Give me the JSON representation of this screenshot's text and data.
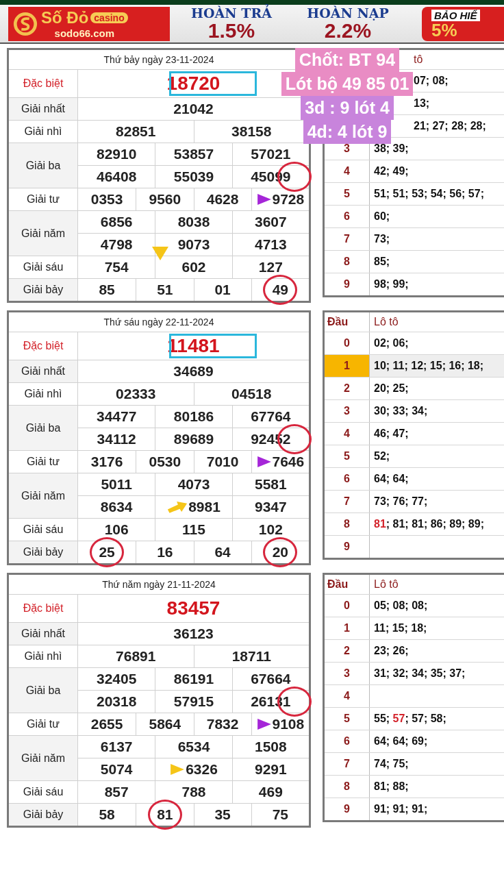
{
  "banner": {
    "brand": "Số Đỏ",
    "brand_tag": "casino",
    "site": "sodo66.com",
    "offers": [
      {
        "title": "HOÀN TRẢ",
        "value": "1.5%"
      },
      {
        "title": "HOÀN NẠP",
        "value": "2.2%"
      }
    ],
    "promo": {
      "title": "BẢO HIỂ",
      "value": "5%"
    }
  },
  "days": [
    {
      "date": "Thứ bảy ngày 23-11-2024",
      "note": [
        "Chốt: BT 94",
        "Lót bộ 49 85 01",
        "3d : 9 lót 4",
        "4d: 4 lót 9"
      ],
      "prizes": [
        {
          "label": "Đặc biệt",
          "kind": "special",
          "rows": [
            [
              {
                "v": "18720",
                "kind": "boxed"
              }
            ]
          ]
        },
        {
          "label": "Giải nhất",
          "kind": "normal",
          "rows": [
            [
              {
                "v": "21042",
                "kind": "plain"
              }
            ]
          ]
        },
        {
          "label": "Giải nhì",
          "kind": "normal",
          "rows": [
            [
              {
                "v": "82851",
                "kind": "plain"
              },
              {
                "v": "38158",
                "kind": "plain"
              }
            ]
          ]
        },
        {
          "label": "Giải ba",
          "kind": "normal",
          "rows": [
            [
              {
                "v": "82910",
                "kind": "plain"
              },
              {
                "v": "53857",
                "kind": "plain"
              },
              {
                "v": "57021",
                "kind": "plain"
              }
            ],
            [
              {
                "v": "46408",
                "kind": "plain"
              },
              {
                "v": "55039",
                "kind": "plain"
              },
              {
                "v": "45099",
                "kind": "tailcircled"
              }
            ]
          ]
        },
        {
          "label": "Giải tư",
          "kind": "normal",
          "rows": [
            [
              {
                "v": "0353",
                "kind": "plain"
              },
              {
                "v": "9560",
                "kind": "plain"
              },
              {
                "v": "4628",
                "kind": "plain"
              },
              {
                "v": "9728",
                "kind": "pointed"
              }
            ]
          ]
        },
        {
          "label": "Giải năm",
          "kind": "normal",
          "rows": [
            [
              {
                "v": "6856",
                "kind": "plain"
              },
              {
                "v": "8038",
                "kind": "plain"
              },
              {
                "v": "3607",
                "kind": "plain"
              }
            ],
            [
              {
                "v": "4798",
                "kind": "plain"
              },
              {
                "v": "9073",
                "kind": "downhinted"
              },
              {
                "v": "4713",
                "kind": "plain"
              }
            ]
          ]
        },
        {
          "label": "Giải sáu",
          "kind": "normal",
          "rows": [
            [
              {
                "v": "754",
                "kind": "plain"
              },
              {
                "v": "602",
                "kind": "plain"
              },
              {
                "v": "127",
                "kind": "plain"
              }
            ]
          ]
        },
        {
          "label": "Giải bảy",
          "kind": "normal",
          "rows": [
            [
              {
                "v": "85",
                "kind": "plain"
              },
              {
                "v": "51",
                "kind": "plain"
              },
              {
                "v": "01",
                "kind": "plain"
              },
              {
                "v": "49",
                "kind": "circled"
              }
            ]
          ]
        }
      ],
      "loto": {
        "title": "tô",
        "rows": [
          {
            "text": "07; 08;"
          },
          {
            "text": "13;"
          },
          {
            "text": "21; 27; 28; 28;"
          },
          {
            "head": "3",
            "text": "38; 39;",
            "highlight": false
          },
          {
            "head": "4",
            "text": "42; 49;",
            "highlight": false
          },
          {
            "head": "5",
            "text": "51; 51; 53; 54; 56; 57;",
            "highlight": false
          },
          {
            "head": "6",
            "text": "60;",
            "highlight": false
          },
          {
            "head": "7",
            "text": "73;",
            "highlight": false
          },
          {
            "head": "8",
            "text": "85;",
            "highlight": false
          },
          {
            "head": "9",
            "text": "98; 99;",
            "highlight": false
          }
        ]
      }
    },
    {
      "date": "Thứ sáu ngày 22-11-2024",
      "prizes": [
        {
          "label": "Đặc biệt",
          "kind": "special",
          "rows": [
            [
              {
                "v": "11481",
                "kind": "boxed"
              }
            ]
          ]
        },
        {
          "label": "Giải nhất",
          "kind": "normal",
          "rows": [
            [
              {
                "v": "34689",
                "kind": "plain"
              }
            ]
          ]
        },
        {
          "label": "Giải nhì",
          "kind": "normal",
          "rows": [
            [
              {
                "v": "02333",
                "kind": "plain"
              },
              {
                "v": "04518",
                "kind": "plain"
              }
            ]
          ]
        },
        {
          "label": "Giải ba",
          "kind": "normal",
          "rows": [
            [
              {
                "v": "34477",
                "kind": "plain"
              },
              {
                "v": "80186",
                "kind": "plain"
              },
              {
                "v": "67764",
                "kind": "plain"
              }
            ],
            [
              {
                "v": "34112",
                "kind": "plain"
              },
              {
                "v": "89689",
                "kind": "plain"
              },
              {
                "v": "92452",
                "kind": "tailcircled"
              }
            ]
          ]
        },
        {
          "label": "Giải tư",
          "kind": "normal",
          "rows": [
            [
              {
                "v": "3176",
                "kind": "plain"
              },
              {
                "v": "0530",
                "kind": "plain"
              },
              {
                "v": "7010",
                "kind": "plain"
              },
              {
                "v": "7646",
                "kind": "pointed"
              }
            ]
          ]
        },
        {
          "label": "Giải năm",
          "kind": "normal",
          "rows": [
            [
              {
                "v": "5011",
                "kind": "plain"
              },
              {
                "v": "4073",
                "kind": "plain"
              },
              {
                "v": "5581",
                "kind": "plain"
              }
            ],
            [
              {
                "v": "8634",
                "kind": "plain"
              },
              {
                "v": "8981",
                "kind": "arrowed"
              },
              {
                "v": "9347",
                "kind": "plain"
              }
            ]
          ]
        },
        {
          "label": "Giải sáu",
          "kind": "normal",
          "rows": [
            [
              {
                "v": "106",
                "kind": "plain"
              },
              {
                "v": "115",
                "kind": "plain"
              },
              {
                "v": "102",
                "kind": "plain"
              }
            ]
          ]
        },
        {
          "label": "Giải bảy",
          "kind": "normal",
          "rows": [
            [
              {
                "v": "25",
                "kind": "circled"
              },
              {
                "v": "16",
                "kind": "plain"
              },
              {
                "v": "64",
                "kind": "plain"
              },
              {
                "v": "20",
                "kind": "circled"
              }
            ]
          ]
        }
      ],
      "loto": {
        "head": "Đầu",
        "title": "Lô tô",
        "rows": [
          {
            "head": "0",
            "text": "02; 06;",
            "highlight": false
          },
          {
            "head": "1",
            "text": "10; 11; 12; 15; 16; 18;",
            "highlight": true
          },
          {
            "head": "2",
            "text": "20; 25;",
            "highlight": false
          },
          {
            "head": "3",
            "text": "30; 33; 34;",
            "highlight": false
          },
          {
            "head": "4",
            "text": "46; 47;",
            "highlight": false
          },
          {
            "head": "5",
            "text": "52;",
            "highlight": false
          },
          {
            "head": "6",
            "text": "64; 64;",
            "highlight": false
          },
          {
            "head": "7",
            "text": "73; 76; 77;",
            "highlight": false
          },
          {
            "head": "8",
            "parts": [
              {
                "t": "81",
                "hot": true
              },
              {
                "t": "; 81; 81; 86; 89; 89;",
                "hot": false
              }
            ],
            "highlight": false
          },
          {
            "head": "9",
            "highlight": false
          }
        ]
      }
    },
    {
      "date": "Thứ năm ngày 21-11-2024",
      "prizes": [
        {
          "label": "Đặc biệt",
          "kind": "special",
          "rows": [
            [
              {
                "v": "83457",
                "kind": "plain"
              }
            ]
          ]
        },
        {
          "label": "Giải nhất",
          "kind": "normal",
          "rows": [
            [
              {
                "v": "36123",
                "kind": "plain"
              }
            ]
          ]
        },
        {
          "label": "Giải nhì",
          "kind": "normal",
          "rows": [
            [
              {
                "v": "76891",
                "kind": "plain"
              },
              {
                "v": "18711",
                "kind": "plain"
              }
            ]
          ]
        },
        {
          "label": "Giải ba",
          "kind": "normal",
          "rows": [
            [
              {
                "v": "32405",
                "kind": "plain"
              },
              {
                "v": "86191",
                "kind": "plain"
              },
              {
                "v": "67664",
                "kind": "plain"
              }
            ],
            [
              {
                "v": "20318",
                "kind": "plain"
              },
              {
                "v": "57915",
                "kind": "plain"
              },
              {
                "v": "26131",
                "kind": "tailcircled"
              }
            ]
          ]
        },
        {
          "label": "Giải tư",
          "kind": "normal",
          "rows": [
            [
              {
                "v": "2655",
                "kind": "plain"
              },
              {
                "v": "5864",
                "kind": "plain"
              },
              {
                "v": "7832",
                "kind": "plain"
              },
              {
                "v": "9108",
                "kind": "pointed"
              }
            ]
          ]
        },
        {
          "label": "Giải năm",
          "kind": "normal",
          "rows": [
            [
              {
                "v": "6137",
                "kind": "plain"
              },
              {
                "v": "6534",
                "kind": "plain"
              },
              {
                "v": "1508",
                "kind": "plain"
              }
            ],
            [
              {
                "v": "5074",
                "kind": "plain"
              },
              {
                "v": "6326",
                "kind": "hinted"
              },
              {
                "v": "9291",
                "kind": "plain"
              }
            ]
          ]
        },
        {
          "label": "Giải sáu",
          "kind": "normal",
          "rows": [
            [
              {
                "v": "857",
                "kind": "plain"
              },
              {
                "v": "788",
                "kind": "plain"
              },
              {
                "v": "469",
                "kind": "plain"
              }
            ]
          ]
        },
        {
          "label": "Giải bảy",
          "kind": "normal",
          "rows": [
            [
              {
                "v": "58",
                "kind": "plain"
              },
              {
                "v": "81",
                "kind": "circled"
              },
              {
                "v": "35",
                "kind": "plain"
              },
              {
                "v": "75",
                "kind": "plain"
              }
            ]
          ]
        }
      ],
      "loto": {
        "head": "Đầu",
        "title": "Lô tô",
        "rows": [
          {
            "head": "0",
            "text": "05; 08; 08;",
            "highlight": false
          },
          {
            "head": "1",
            "text": "11; 15; 18;",
            "highlight": false
          },
          {
            "head": "2",
            "text": "23; 26;",
            "highlight": false
          },
          {
            "head": "3",
            "text": "31; 32; 34; 35; 37;",
            "highlight": false
          },
          {
            "head": "4",
            "highlight": false
          },
          {
            "head": "5",
            "parts": [
              {
                "t": "55; ",
                "hot": false
              },
              {
                "t": "57",
                "hot": true
              },
              {
                "t": "; 57; 58;",
                "hot": false
              }
            ],
            "highlight": false
          },
          {
            "head": "6",
            "text": "64; 64; 69;",
            "highlight": false
          },
          {
            "head": "7",
            "text": "74; 75;",
            "highlight": false
          },
          {
            "head": "8",
            "text": "81; 88;",
            "highlight": false
          },
          {
            "head": "9",
            "text": "91; 91; 91;",
            "highlight": false
          }
        ]
      }
    }
  ]
}
